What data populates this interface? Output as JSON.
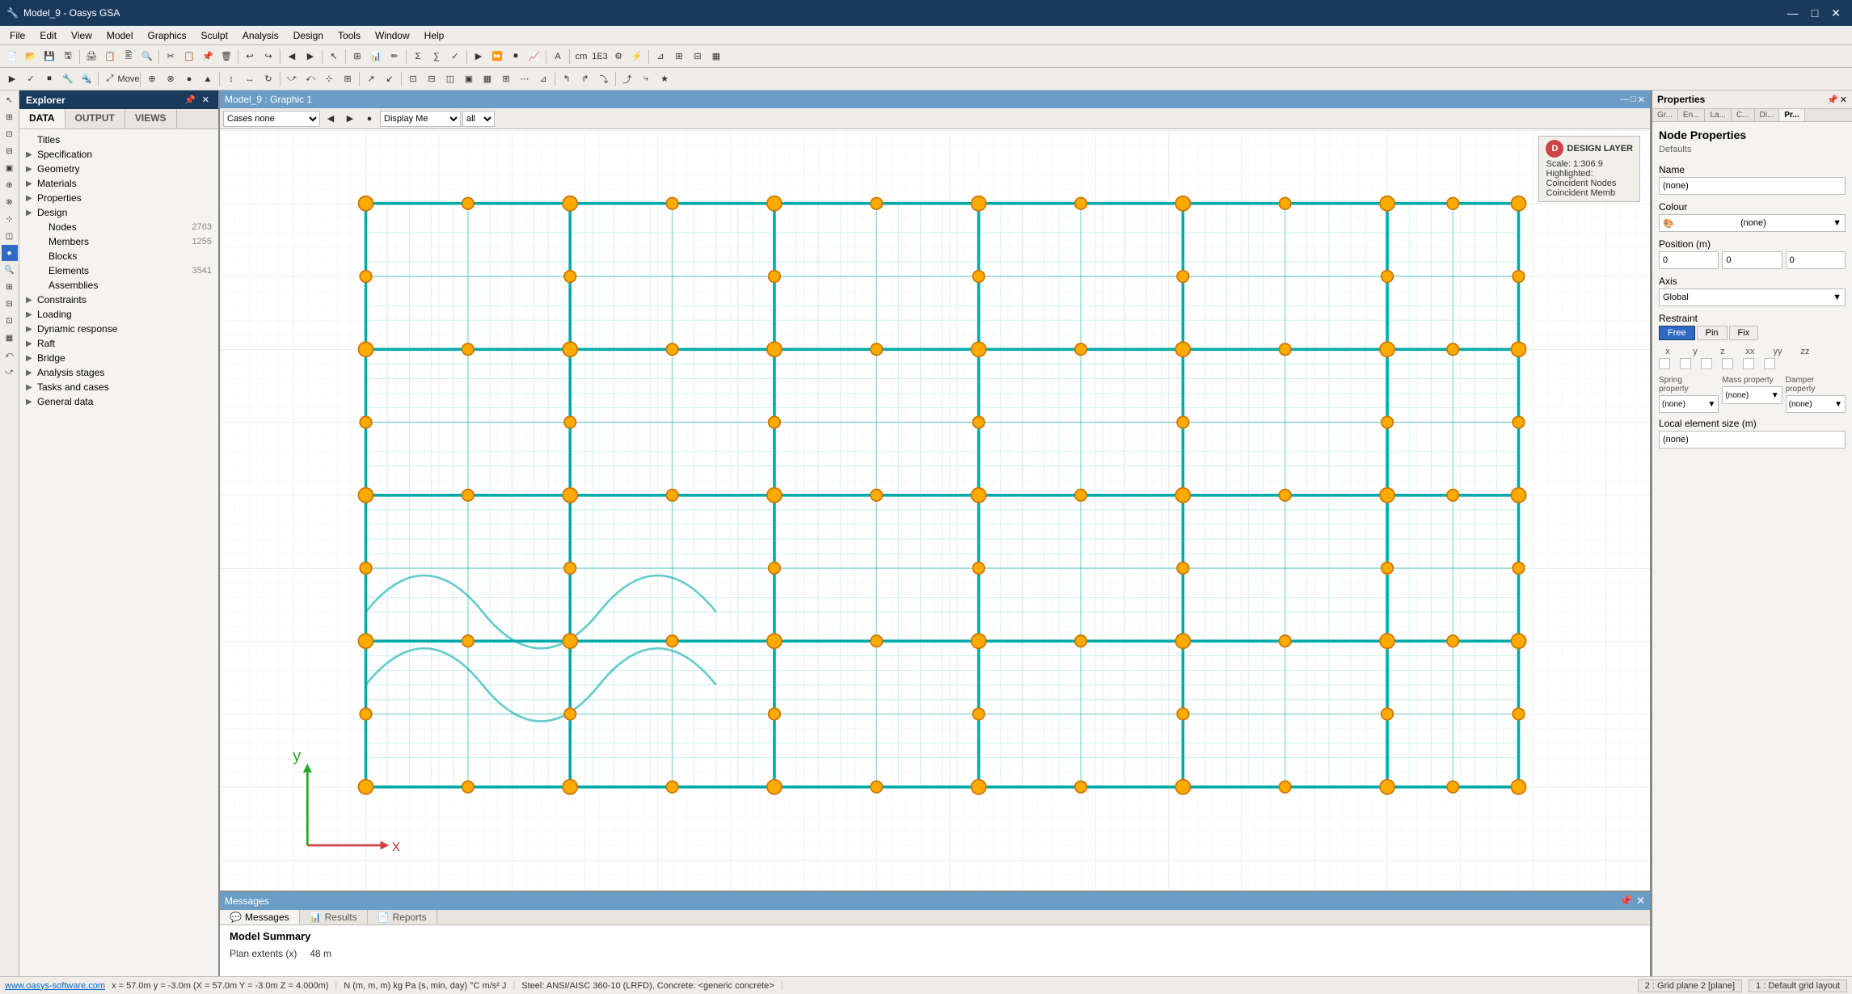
{
  "app": {
    "title": "Model_9 - Oasys GSA",
    "icon": "🔧"
  },
  "titlebar": {
    "minimize": "—",
    "maximize": "□",
    "close": "✕"
  },
  "menubar": {
    "items": [
      "File",
      "Edit",
      "View",
      "Model",
      "Graphics",
      "Sculpt",
      "Analysis",
      "Design",
      "Tools",
      "Window",
      "Help"
    ]
  },
  "explorer": {
    "title": "Explorer",
    "tabs": [
      "DATA",
      "OUTPUT",
      "VIEWS"
    ],
    "active_tab": "DATA",
    "tree": [
      {
        "id": "titles",
        "label": "Titles",
        "indent": 0,
        "arrow": false
      },
      {
        "id": "specification",
        "label": "Specification",
        "indent": 0,
        "arrow": true
      },
      {
        "id": "geometry",
        "label": "Geometry",
        "indent": 0,
        "arrow": true
      },
      {
        "id": "materials",
        "label": "Materials",
        "indent": 0,
        "arrow": true
      },
      {
        "id": "properties",
        "label": "Properties",
        "indent": 0,
        "arrow": true
      },
      {
        "id": "design",
        "label": "Design",
        "indent": 0,
        "arrow": true
      },
      {
        "id": "nodes",
        "label": "Nodes",
        "count": "2763",
        "indent": 1,
        "arrow": false
      },
      {
        "id": "members",
        "label": "Members",
        "count": "1255",
        "indent": 1,
        "arrow": false
      },
      {
        "id": "blocks",
        "label": "Blocks",
        "indent": 1,
        "arrow": false
      },
      {
        "id": "elements",
        "label": "Elements",
        "count": "3541",
        "indent": 1,
        "arrow": false
      },
      {
        "id": "assemblies",
        "label": "Assemblies",
        "indent": 1,
        "arrow": false
      },
      {
        "id": "constraints",
        "label": "Constraints",
        "indent": 0,
        "arrow": true
      },
      {
        "id": "loading",
        "label": "Loading",
        "indent": 0,
        "arrow": true
      },
      {
        "id": "dynamic_response",
        "label": "Dynamic response",
        "indent": 0,
        "arrow": true
      },
      {
        "id": "raft",
        "label": "Raft",
        "indent": 0,
        "arrow": true
      },
      {
        "id": "bridge",
        "label": "Bridge",
        "indent": 0,
        "arrow": true
      },
      {
        "id": "analysis_stages",
        "label": "Analysis stages",
        "indent": 0,
        "arrow": true
      },
      {
        "id": "tasks_cases",
        "label": "Tasks and cases",
        "indent": 0,
        "arrow": true
      },
      {
        "id": "general_data",
        "label": "General data",
        "indent": 0,
        "arrow": true
      }
    ]
  },
  "graphic_window": {
    "title": "Model_9 : Graphic 1",
    "cases_label": "Cases none",
    "display_label": "Display Me",
    "design_layer": {
      "circle": "D",
      "title": "DESIGN LAYER",
      "scale": "Scale: 1:306.9",
      "highlighted_label": "Highlighted:",
      "coincident_nodes": "Coincident Nodes",
      "coincident_members": "Coincident Memb"
    }
  },
  "properties_panel": {
    "title": "Properties",
    "tabs": [
      "Gr...",
      "En...",
      "La...",
      "C...",
      "Di...",
      "Pr..."
    ],
    "active_tab": "Pr...",
    "node_properties": {
      "title": "Node Properties",
      "subtitle": "Defaults",
      "name_label": "Name",
      "name_value": "(none)",
      "colour_label": "Colour",
      "colour_value": "(none)",
      "position_label": "Position (m)",
      "pos_x": "0",
      "pos_y": "0",
      "pos_z": "0",
      "axis_label": "Axis",
      "axis_value": "Global",
      "restraint_label": "Restraint",
      "restraint_btns": [
        "Free",
        "Pin",
        "Fix"
      ],
      "active_restraint": "Free",
      "axis_labels": [
        "x",
        "y",
        "z",
        "xx",
        "yy",
        "zz"
      ],
      "spring_label": "Spring\nproperty",
      "spring_value": "(none)",
      "mass_label": "Mass property",
      "mass_value": "(none)",
      "damper_label": "Damper\nproperty",
      "damper_value": "(none)",
      "local_element_label": "Local element size (m)",
      "local_element_value": "(none)"
    }
  },
  "messages": {
    "title": "Messages",
    "tabs": [
      "Messages",
      "Results",
      "Reports"
    ],
    "active_tab": "Messages",
    "summary_title": "Model Summary",
    "rows": [
      {
        "label": "Plan extents (x)",
        "value": "48 m"
      }
    ]
  },
  "statusbar": {
    "website": "www.oasys-software.com",
    "coords": "x = 57.0m  y = -3.0m  (X = 57.0m  Y = -3.0m  Z = 4.000m)",
    "units": "N (m, m, m)  kg  Pa (s, min, day)  °C m/s²  J",
    "steel": "Steel: ANSI/AISC 360-10 (LRFD), Concrete: <generic concrete>",
    "grid": "2 : Grid plane 2 [plane]",
    "layout": "1 : Default grid layout"
  }
}
